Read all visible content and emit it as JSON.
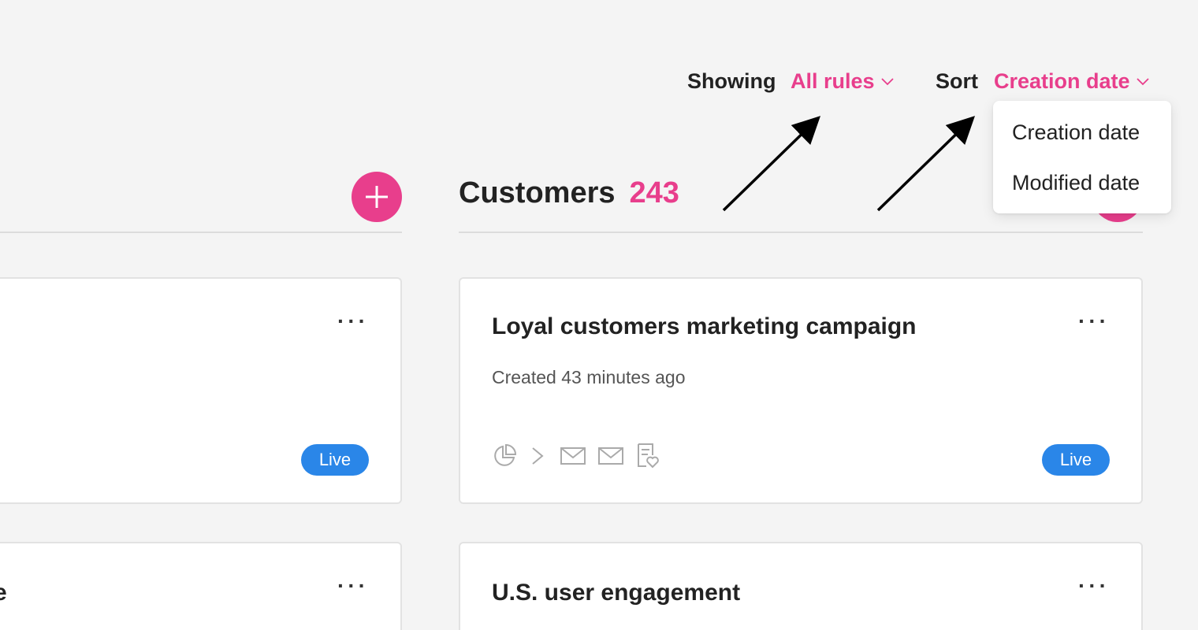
{
  "filters": {
    "showing_label": "Showing",
    "showing_value": "All rules",
    "sort_label": "Sort",
    "sort_value": "Creation date"
  },
  "sort_dropdown": {
    "options": [
      "Creation date",
      "Modified date"
    ]
  },
  "customers_column": {
    "title": "Customers",
    "count": "243"
  },
  "cards": [
    {
      "title": "Loyal customers marketing campaign",
      "meta": "Created 43 minutes ago",
      "status": "Live",
      "icons": [
        "pie-chart-icon",
        "chevron-right-icon",
        "mail-icon",
        "mail-icon",
        "survey-heart-icon"
      ]
    },
    {
      "title": "U.S. user engagement"
    }
  ],
  "left_column": {
    "card_status": "Live",
    "partial_text": "e"
  },
  "colors": {
    "accent": "#e83e8c",
    "live_badge": "#2a86e8",
    "background": "#f4f4f4"
  }
}
